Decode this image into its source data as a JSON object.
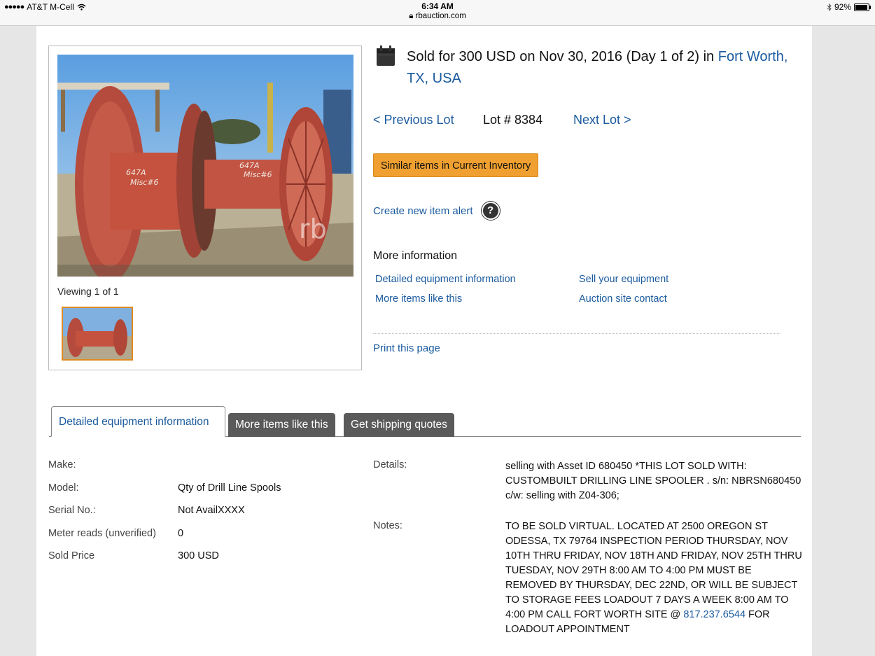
{
  "status_bar": {
    "carrier": "AT&T M-Cell",
    "time": "6:34 AM",
    "url": "rbauction.com",
    "battery": "92%",
    "battery_level": 0.92
  },
  "gallery": {
    "viewing": "Viewing 1 of 1",
    "photo_marks": [
      "647A",
      "Misc#6",
      "rb"
    ]
  },
  "sale": {
    "sold_prefix": "Sold for",
    "price": "300",
    "currency": "USD",
    "on_text": "on Nov 30, 2016 (Day 1 of 2) in",
    "location": "Fort Worth, TX, USA"
  },
  "lot_nav": {
    "previous": "< Previous Lot",
    "lot_number": "Lot # 8384",
    "next": "Next Lot >"
  },
  "similar_button": "Similar items in Current Inventory",
  "alert_link": "Create new item alert",
  "help_glyph": "?",
  "more_info": {
    "title": "More information",
    "links": [
      "Detailed equipment information",
      "Sell your equipment",
      "More items like this",
      "Auction site contact"
    ]
  },
  "print_link": "Print this page",
  "tabs": [
    "Detailed equipment information",
    "More items like this",
    "Get shipping quotes"
  ],
  "specs": [
    {
      "label": "Make:",
      "value": ""
    },
    {
      "label": "Model:",
      "value": "Qty of Drill Line Spools"
    },
    {
      "label": "Serial No.:",
      "value": "Not AvailXXXX"
    },
    {
      "label": "Meter reads (unverified)",
      "value": "0"
    },
    {
      "label": "Sold Price",
      "value": "300",
      "unit": "USD"
    }
  ],
  "details": {
    "label": "Details:",
    "text": "selling with Asset ID 680450 *THIS LOT SOLD WITH: CUSTOMBUILT DRILLING LINE SPOOLER . s/n: NBRSN680450 c/w: selling with Z04-306;"
  },
  "notes": {
    "label": "Notes:",
    "text": "TO BE SOLD VIRTUAL. LOCATED AT 2500 OREGON ST ODESSA, TX 79764 INSPECTION PERIOD THURSDAY, NOV 10TH THRU FRIDAY, NOV 18TH AND FRIDAY, NOV 25TH THRU TUESDAY, NOV 29TH 8:00 AM TO 4:00 PM MUST BE REMOVED BY THURSDAY, DEC 22ND, OR WILL BE SUBJECT TO STORAGE FEES LOADOUT 7 DAYS A WEEK 8:00 AM TO 4:00 PM CALL FORT WORTH SITE @",
    "phone": "817.237.6544",
    "tail": "FOR LOADOUT APPOINTMENT"
  },
  "colors": {
    "link": "#1a5a9e",
    "button": "#f0a030",
    "tab_inactive": "#5a5a5a"
  }
}
